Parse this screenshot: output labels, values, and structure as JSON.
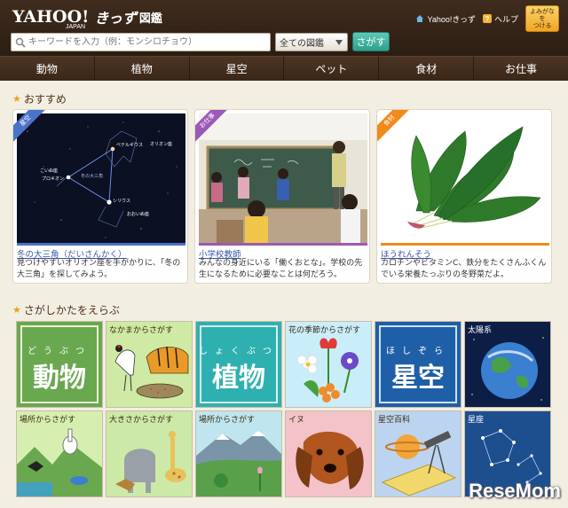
{
  "header": {
    "logo": {
      "yahoo": "YAHOO!",
      "japan": "JAPAN",
      "kids": "きっず",
      "zukan": "図鑑"
    },
    "links": {
      "home": "Yahoo!きっず",
      "help": "ヘルプ",
      "furigana_line1": "よみがなを",
      "furigana_line2": "つける"
    },
    "search": {
      "placeholder": "キーワードを入力（例：モンシロチョウ）",
      "select_value": "全ての図鑑",
      "button": "さがす"
    }
  },
  "nav": {
    "items": [
      "動物",
      "植物",
      "星空",
      "ペット",
      "食材",
      "お仕事"
    ]
  },
  "recommend": {
    "title": "おすすめ",
    "cards": [
      {
        "tag": "星空",
        "title": "冬の大三角（だいさんかく）",
        "desc": "見つけやすいオリオン座を手がかりに、「冬の大三角」を探してみよう。",
        "color": "#4a72c9",
        "labels": {
          "orion": "オリオン座",
          "betelgeuse": "ベテルギウス",
          "procyon": "プロキオン",
          "koinu": "こいぬ座",
          "sirius": "シリウス",
          "oinu": "おおいぬ座",
          "triangle": "冬の大三角"
        }
      },
      {
        "tag": "お仕事",
        "title": "小学校教師",
        "desc": "みんなの身近にいる「働くおとな」。学校の先生になるために必要なことは何だろう。",
        "color": "#9b59b6"
      },
      {
        "tag": "食材",
        "title": "ほうれんそう",
        "desc": "カロチンやビタミンC、鉄分をたくさんふくんでいる栄養たっぷりの冬野菜だよ。",
        "color": "#f08a1c"
      }
    ]
  },
  "browse": {
    "title": "さがしかたをえらぶ",
    "tiles": [
      {
        "label": "",
        "big": "動物",
        "ruby": "どうぶつ"
      },
      {
        "label": "なかまからさがす"
      },
      {
        "label": "",
        "big": "植物",
        "ruby": "しょくぶつ"
      },
      {
        "label": "花の季節からさがす"
      },
      {
        "label": "",
        "big": "星空",
        "ruby": "ほしぞら"
      },
      {
        "label": "太陽系"
      },
      {
        "label": "場所からさがす"
      },
      {
        "label": "大きさからさがす"
      },
      {
        "label": "場所からさがす"
      },
      {
        "label": "イヌ"
      },
      {
        "label": "星空百科"
      },
      {
        "label": "星座"
      }
    ]
  },
  "watermark": "ReseMom"
}
